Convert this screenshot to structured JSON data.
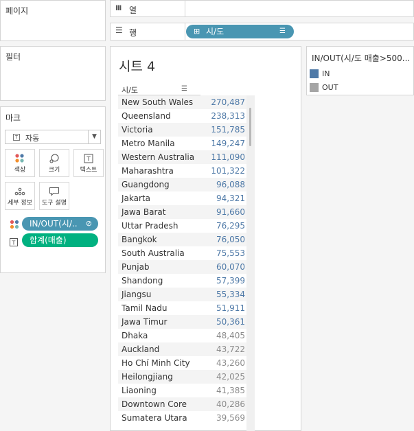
{
  "left": {
    "pages_title": "페이지",
    "filters_title": "필터",
    "marks_title": "마크",
    "mark_type": "자동",
    "mark_buttons": [
      {
        "label": "색상",
        "icon": "color-icon"
      },
      {
        "label": "크기",
        "icon": "size-icon"
      },
      {
        "label": "텍스트",
        "icon": "text-icon"
      },
      {
        "label": "세부 정보",
        "icon": "detail-icon"
      },
      {
        "label": "도구 설명",
        "icon": "tooltip-icon"
      }
    ],
    "pills": [
      {
        "label": "IN/OUT(시/..",
        "icon": "color-icon"
      },
      {
        "label": "합계(매출)",
        "icon": "text-icon"
      }
    ]
  },
  "shelves": {
    "columns_label": "열",
    "rows_label": "행",
    "rows_pill": "시/도"
  },
  "sheet": {
    "title": "시트 4",
    "column_header": "시/도",
    "rows": [
      {
        "name": "New South Wales",
        "value": "270,487",
        "group": "IN"
      },
      {
        "name": "Queensland",
        "value": "238,313",
        "group": "IN"
      },
      {
        "name": "Victoria",
        "value": "151,785",
        "group": "IN"
      },
      {
        "name": "Metro Manila",
        "value": "149,247",
        "group": "IN"
      },
      {
        "name": "Western Australia",
        "value": "111,090",
        "group": "IN"
      },
      {
        "name": "Maharashtra",
        "value": "101,322",
        "group": "IN"
      },
      {
        "name": "Guangdong",
        "value": "96,088",
        "group": "IN"
      },
      {
        "name": "Jakarta",
        "value": "94,321",
        "group": "IN"
      },
      {
        "name": "Jawa Barat",
        "value": "91,660",
        "group": "IN"
      },
      {
        "name": "Uttar Pradesh",
        "value": "76,295",
        "group": "IN"
      },
      {
        "name": "Bangkok",
        "value": "76,050",
        "group": "IN"
      },
      {
        "name": "South Australia",
        "value": "75,553",
        "group": "IN"
      },
      {
        "name": "Punjab",
        "value": "60,070",
        "group": "IN"
      },
      {
        "name": "Shandong",
        "value": "57,399",
        "group": "IN"
      },
      {
        "name": "Jiangsu",
        "value": "55,334",
        "group": "IN"
      },
      {
        "name": "Tamil Nadu",
        "value": "51,911",
        "group": "IN"
      },
      {
        "name": "Jawa Timur",
        "value": "50,361",
        "group": "IN"
      },
      {
        "name": "Dhaka",
        "value": "48,405",
        "group": "OUT"
      },
      {
        "name": "Auckland",
        "value": "43,722",
        "group": "OUT"
      },
      {
        "name": "Ho Chí Minh City",
        "value": "43,260",
        "group": "OUT"
      },
      {
        "name": "Heilongjiang",
        "value": "42,025",
        "group": "OUT"
      },
      {
        "name": "Liaoning",
        "value": "41,385",
        "group": "OUT"
      },
      {
        "name": "Downtown Core",
        "value": "40,286",
        "group": "OUT"
      },
      {
        "name": "Sumatera Utara",
        "value": "39,569",
        "group": "OUT"
      }
    ]
  },
  "legend": {
    "title": "IN/OUT(시/도 매출>500...",
    "items": [
      {
        "label": "IN",
        "color": "#4e79a7"
      },
      {
        "label": "OUT",
        "color": "#a5a5a5"
      }
    ]
  }
}
